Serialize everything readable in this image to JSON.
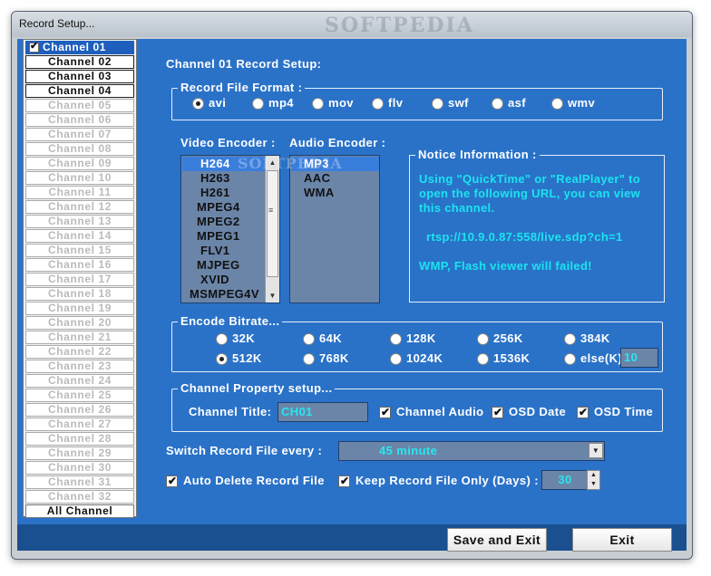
{
  "window": {
    "title": "Record Setup...",
    "watermark": "SOFTPEDIA"
  },
  "channels": [
    {
      "label": "Channel 01",
      "state": "selected"
    },
    {
      "label": "Channel 02",
      "state": "active"
    },
    {
      "label": "Channel 03",
      "state": "active"
    },
    {
      "label": "Channel 04",
      "state": "active"
    },
    {
      "label": "Channel 05",
      "state": "disabled"
    },
    {
      "label": "Channel 06",
      "state": "disabled"
    },
    {
      "label": "Channel 07",
      "state": "disabled"
    },
    {
      "label": "Channel 08",
      "state": "disabled"
    },
    {
      "label": "Channel 09",
      "state": "disabled"
    },
    {
      "label": "Channel 10",
      "state": "disabled"
    },
    {
      "label": "Channel 11",
      "state": "disabled"
    },
    {
      "label": "Channel 12",
      "state": "disabled"
    },
    {
      "label": "Channel 13",
      "state": "disabled"
    },
    {
      "label": "Channel 14",
      "state": "disabled"
    },
    {
      "label": "Channel 15",
      "state": "disabled"
    },
    {
      "label": "Channel 16",
      "state": "disabled"
    },
    {
      "label": "Channel 17",
      "state": "disabled"
    },
    {
      "label": "Channel 18",
      "state": "disabled"
    },
    {
      "label": "Channel 19",
      "state": "disabled"
    },
    {
      "label": "Channel 20",
      "state": "disabled"
    },
    {
      "label": "Channel 21",
      "state": "disabled"
    },
    {
      "label": "Channel 22",
      "state": "disabled"
    },
    {
      "label": "Channel 23",
      "state": "disabled"
    },
    {
      "label": "Channel 24",
      "state": "disabled"
    },
    {
      "label": "Channel 25",
      "state": "disabled"
    },
    {
      "label": "Channel 26",
      "state": "disabled"
    },
    {
      "label": "Channel 27",
      "state": "disabled"
    },
    {
      "label": "Channel 28",
      "state": "disabled"
    },
    {
      "label": "Channel 29",
      "state": "disabled"
    },
    {
      "label": "Channel 30",
      "state": "disabled"
    },
    {
      "label": "Channel 31",
      "state": "disabled"
    },
    {
      "label": "Channel 32",
      "state": "disabled"
    },
    {
      "label": "All Channel",
      "state": "all"
    }
  ],
  "main": {
    "heading": "Channel 01 Record Setup:",
    "format": {
      "legend": "Record File Format :",
      "options": [
        "avi",
        "mp4",
        "mov",
        "flv",
        "swf",
        "asf",
        "wmv"
      ],
      "selected": "avi"
    },
    "video_encoder": {
      "label": "Video Encoder :",
      "items": [
        "H264",
        "H263",
        "H261",
        "MPEG4",
        "MPEG2",
        "MPEG1",
        "FLV1",
        "MJPEG",
        "XVID",
        "MSMPEG4V"
      ],
      "selected": "H264"
    },
    "audio_encoder": {
      "label": "Audio Encoder :",
      "items": [
        "MP3",
        "AAC",
        "WMA"
      ],
      "selected": "MP3"
    },
    "notice": {
      "legend": "Notice Information :",
      "line1": "Using \"QuickTime\" or \"RealPlayer\" to",
      "line2": "open the following URL, you can view",
      "line3": "this channel.",
      "url": "rtsp://10.9.0.87:558/live.sdp?ch=1",
      "warning": "WMP, Flash viewer will failed!"
    },
    "bitrate": {
      "legend": "Encode Bitrate...",
      "row1": [
        "32K",
        "64K",
        "128K",
        "256K",
        "384K"
      ],
      "row2": [
        "512K",
        "768K",
        "1024K",
        "1536K",
        "else(K)"
      ],
      "selected": "512K",
      "else_value": "10"
    },
    "property": {
      "legend": "Channel Property setup...",
      "title_label": "Channel Title:",
      "title_value": "CH01",
      "audio_label": "Channel Audio",
      "osd_date_label": "OSD Date",
      "osd_time_label": "OSD Time"
    },
    "switch": {
      "label": "Switch Record File every :",
      "value": "45 minute"
    },
    "auto_delete_label": "Auto Delete Record File",
    "keep": {
      "label": "Keep Record File Only (Days) :",
      "value": "30"
    }
  },
  "buttons": {
    "save": "Save and Exit",
    "exit": "Exit"
  },
  "colors": {
    "panel": "#2a72c8",
    "accent_text": "#1be4ef",
    "bottom_bar": "#1a4f90"
  }
}
